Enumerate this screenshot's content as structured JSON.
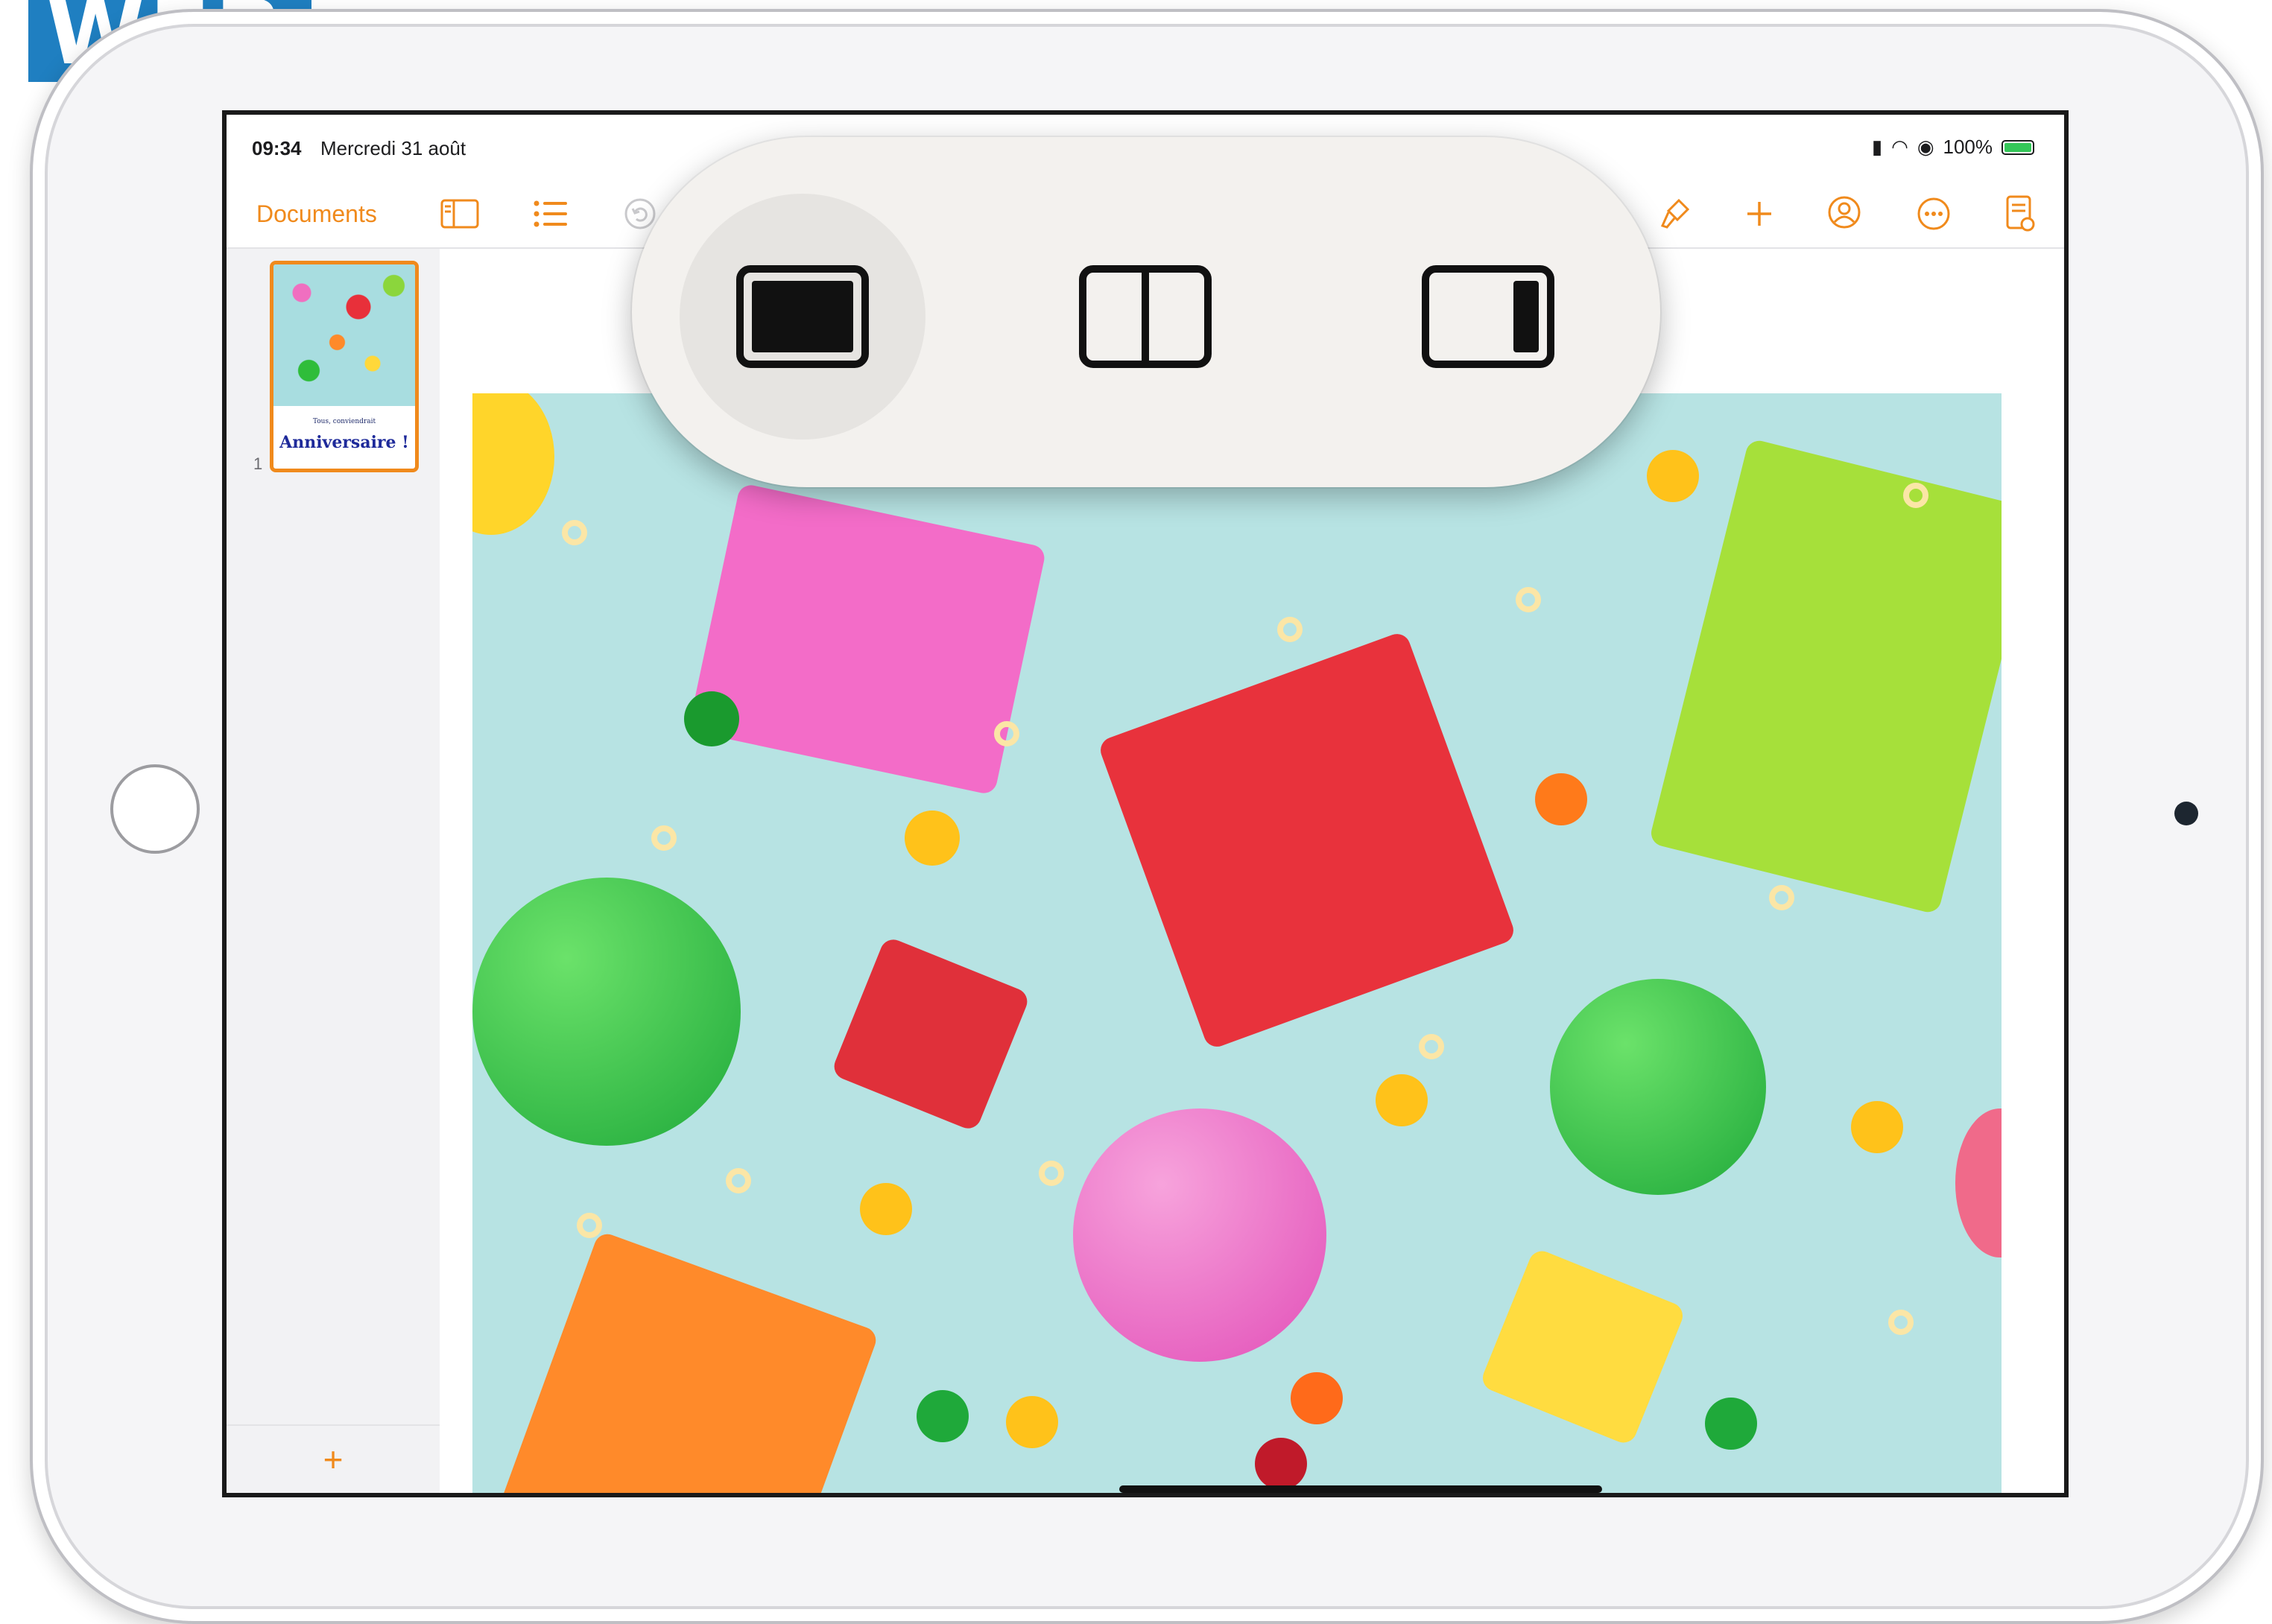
{
  "logo": {
    "text": "WEB"
  },
  "status_bar": {
    "time": "09:34",
    "date": "Mercredi 31 août",
    "battery": "100%"
  },
  "toolbar": {
    "documents_label": "Documents",
    "icons": [
      "sidebar-icon",
      "list-icon",
      "undo-icon",
      "brush-icon",
      "plus-icon",
      "collaborate-icon",
      "more-icon",
      "document-options-icon"
    ]
  },
  "sidebar": {
    "page_number": "1",
    "thumbnail_subtitle": "Tous, conviendrait",
    "thumbnail_title": "Anniversaire !",
    "add_label": "+"
  },
  "multitasking": {
    "options": [
      "full-screen-icon",
      "split-view-icon",
      "slide-over-icon"
    ],
    "selected": "full-screen-icon"
  },
  "colors": {
    "accent": "#f08a1c",
    "popover_bg": "#f3f1ee",
    "photo_bg": "#b7e3e3"
  }
}
